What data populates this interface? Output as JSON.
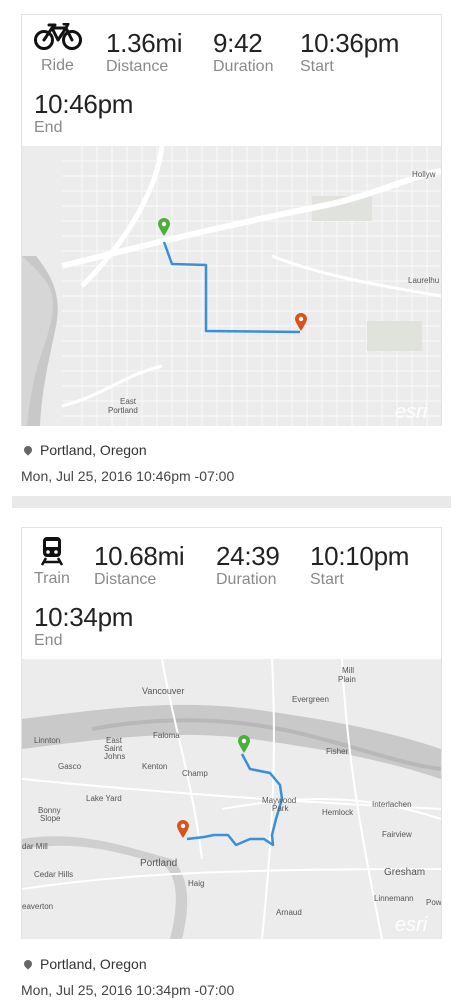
{
  "activities": [
    {
      "type_label": "Ride",
      "icon": "bicycle-icon",
      "distance": "1.36mi",
      "distance_label": "Distance",
      "duration": "9:42",
      "duration_label": "Duration",
      "start": "10:36pm",
      "start_label": "Start",
      "end": "10:46pm",
      "end_label": "End",
      "route_color": "#3b8ed8",
      "map_labels": [
        "Hollyw",
        "Laurelhu",
        "East",
        "Portland"
      ],
      "map_attribution": "esri",
      "location": "Portland, Oregon",
      "date": "Mon, Jul 25, 2016 10:46pm -07:00"
    },
    {
      "type_label": "Train",
      "icon": "train-icon",
      "distance": "10.68mi",
      "distance_label": "Distance",
      "duration": "24:39",
      "duration_label": "Duration",
      "start": "10:10pm",
      "start_label": "Start",
      "end": "10:34pm",
      "end_label": "End",
      "route_color": "#3b8ed8",
      "map_labels": [
        "Vancouver",
        "Mill",
        "Plain",
        "Evergreen",
        "Linnton",
        "East",
        "Saint",
        "Johns",
        "Faloma",
        "Gasco",
        "Kenton",
        "Champ",
        "Fisher",
        "Lake Yard",
        "Maywood",
        "Park",
        "Interlachen",
        "Hemlock",
        "Bonny",
        "Slope",
        "Fairview",
        "dar Mill",
        "Portland",
        "Cedar Hills",
        "Haig",
        "Gresham",
        "Linnemann",
        "eaverton",
        "Arnaud",
        "Pow"
      ],
      "map_attribution": "esri",
      "location": "Portland, Oregon",
      "date": "Mon, Jul 25, 2016 10:34pm -07:00"
    }
  ],
  "colors": {
    "start_marker": "#4caf3a",
    "end_marker": "#d9531e"
  }
}
